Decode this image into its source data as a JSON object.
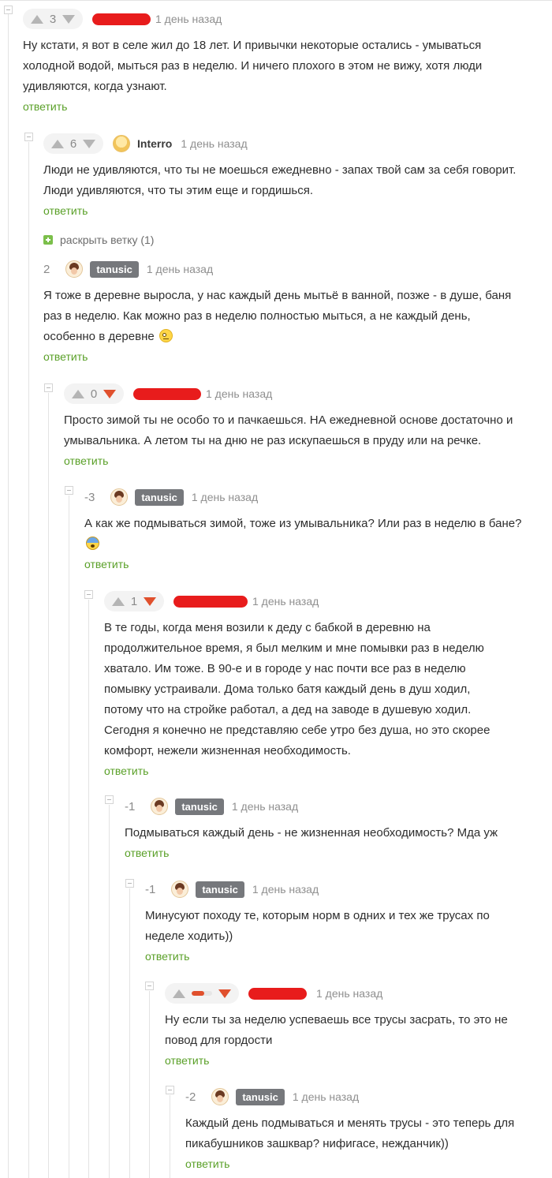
{
  "collapse_icon": "collapse-minus-icon",
  "comments": [
    {
      "score": "3",
      "author": "",
      "author_redacted": true,
      "time": "1 день назад",
      "text": "Ну кстати, я вот в селе жил до 18 лет. И привычки некоторые остались - умываться холодной водой, мыться раз в неделю. И ничего плохого в этом не вижу, хотя люди удивляются, когда узнают.",
      "reply_label": "ответить"
    },
    {
      "score": "6",
      "author": "Interro",
      "time": "1 день назад",
      "text": "Люди не удивляются, что ты не моешься ежедневно - запах твой сам за себя говорит. Люди удивляются, что ты этим еще и гордишься.",
      "reply_label": "ответить"
    },
    {
      "score": "2",
      "author": "tanusic",
      "time": "1 день назад",
      "text": "Я тоже в деревне выросла, у нас каждый день мытьё в ванной, позже - в душе, баня раз в неделю. Как можно раз в неделю полностью мыться, а не каждый день, особенно в деревне",
      "emoji": "rolling-eyes-emoji",
      "reply_label": "ответить"
    },
    {
      "score": "0",
      "author": "",
      "author_redacted": true,
      "time": "1 день назад",
      "text": "Просто зимой ты не особо то и пачкаешься. НА ежедневной основе достаточно и умывальника. А летом ты на дню не раз искупаешься в пруду или на речке.",
      "reply_label": "ответить"
    },
    {
      "score": "-3",
      "author": "tanusic",
      "time": "1 день назад",
      "text": "А как же подмываться зимой, тоже из умывальника? Или раз в неделю в бане?",
      "emoji": "fearful-face-emoji",
      "reply_label": "ответить"
    },
    {
      "score": "1",
      "author": "",
      "author_redacted": true,
      "time": "1 день назад",
      "text": "В те годы, когда меня возили к деду с бабкой в деревню на продолжительное время, я был мелким и мне помывки раз в неделю хватало. Им тоже. В 90-е и в городе у нас почти все раз в неделю помывку устраивали. Дома только батя каждый день в душ ходил, потому что на стройке работал, а дед на заводе в душевую ходил. Сегодня я конечно не представляю себе утро без душа, но это скорее комфорт, нежели жизненная необходимость.",
      "reply_label": "ответить"
    },
    {
      "score": "-1",
      "author": "tanusic",
      "time": "1 день назад",
      "text": "Подмываться каждый день - не жизненная необходимость? Мда уж",
      "reply_label": "ответить"
    },
    {
      "score": "-1",
      "author": "tanusic",
      "time": "1 день назад",
      "text": "Минусуют походу те, которым норм в одних и тех же трусах по неделе ходить))",
      "reply_label": "ответить"
    },
    {
      "score": "",
      "score_fill": 0.6,
      "author": "",
      "author_redacted": true,
      "time": "1 день назад",
      "text": "Ну если ты за неделю успеваешь все трусы засрать, то это не повод для гордости",
      "reply_label": "ответить"
    },
    {
      "score": "-2",
      "author": "tanusic",
      "time": "1 день назад",
      "text": "Каждый день подмываться и менять трусы - это теперь для пикабушников зашквар? нифигасе, нежданчик))",
      "reply_label": "ответить"
    }
  ],
  "expand_branch": {
    "label": "раскрыть ветку (1)"
  },
  "colors": {
    "reply": "#5aa028",
    "downvote_active": "#e0502d",
    "badge": "#76787c",
    "redaction": "#e81c1c"
  }
}
